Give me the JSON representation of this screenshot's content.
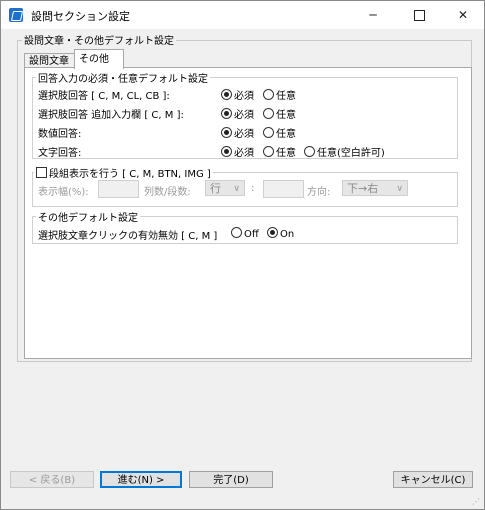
{
  "window": {
    "title": "設問セクション設定",
    "icon": "app-icon",
    "controls": [
      "─",
      "☐",
      "✕"
    ]
  },
  "group_title": "設問文章・その他デフォルト設定",
  "tabs": [
    {
      "label": "設問文章",
      "active": false
    },
    {
      "label": "その他",
      "active": true
    }
  ],
  "required_section": {
    "legend": "回答入力の必須・任意デフォルト設定",
    "rows": [
      {
        "label": "選択肢回答 [ C, M, CL, CB ]:",
        "options": [
          "必須",
          "任意"
        ],
        "selected": "必須"
      },
      {
        "label": "選択肢回答 追加入力欄 [ C, M ]:",
        "options": [
          "必須",
          "任意"
        ],
        "selected": "必須"
      },
      {
        "label": "数値回答:",
        "options": [
          "必須",
          "任意"
        ],
        "selected": "必須"
      },
      {
        "label": "文字回答:",
        "options": [
          "必須",
          "任意",
          "任意(空白許可)"
        ],
        "selected": "必須"
      }
    ]
  },
  "column_section": {
    "checkbox_label": "段組表示を行う [ C, M, BTN, IMG ]",
    "checked": false,
    "width_label": "表示幅(%):",
    "width_value": "",
    "columns_label": "列数/段数:",
    "columns_select": "行",
    "colon": ":",
    "count_value": "",
    "direction_label": "方向:",
    "direction_select": "下→右"
  },
  "other_section": {
    "legend": "その他デフォルト設定",
    "row_label": "選択肢文章クリックの有効無効 [ C, M ]",
    "options": [
      "Off",
      "On"
    ],
    "selected": "On"
  },
  "buttons": {
    "back": "< 戻る(B)",
    "next": "進む(N) >",
    "finish": "完了(D)",
    "cancel": "キャンセル(C)"
  }
}
